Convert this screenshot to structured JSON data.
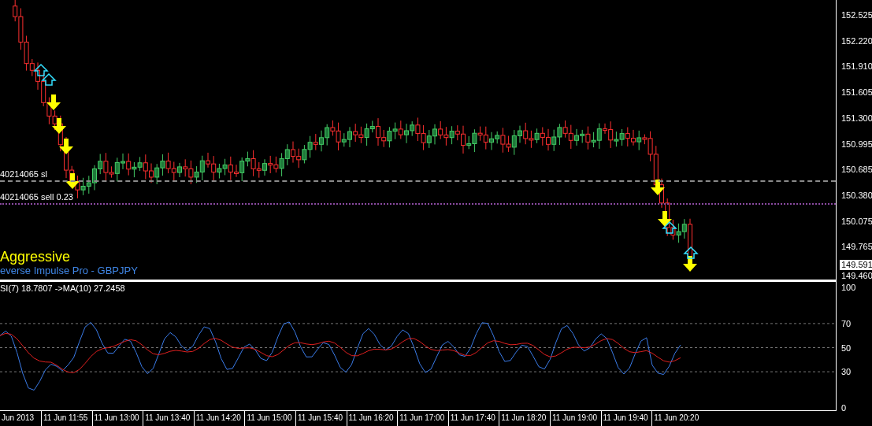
{
  "price_chart": {
    "order_lines": [
      {
        "label": "40214065 sl",
        "color": "#8a8a8a"
      },
      {
        "label": "40214065 sell 0.23",
        "color": "#8a4aa0"
      }
    ],
    "strategy_label": "Aggressive",
    "indicator_name": "everse Impulse Pro - GBPJPY",
    "price_axis": [
      "152.525",
      "152.220",
      "151.910",
      "151.605",
      "151.300",
      "150.995",
      "150.685",
      "150.380",
      "150.075",
      "149.765"
    ],
    "current_price": "149.591",
    "bottom_price": "149.460"
  },
  "oscillator": {
    "label": "SI(7) 18.7807  ->MA(10) 27.2458",
    "axis": [
      "100",
      "70",
      "50",
      "30",
      "0"
    ]
  },
  "time_axis": [
    "Jun 2013",
    "11 Jun 11:55",
    "11 Jun 13:00",
    "11 Jun 13:40",
    "11 Jun 14:20",
    "11 Jun 15:00",
    "11 Jun 15:40",
    "11 Jun 16:20",
    "11 Jun 17:00",
    "11 Jun 17:40",
    "11 Jun 18:20",
    "11 Jun 19:00",
    "11 Jun 19:40",
    "11 Jun 20:20"
  ]
}
